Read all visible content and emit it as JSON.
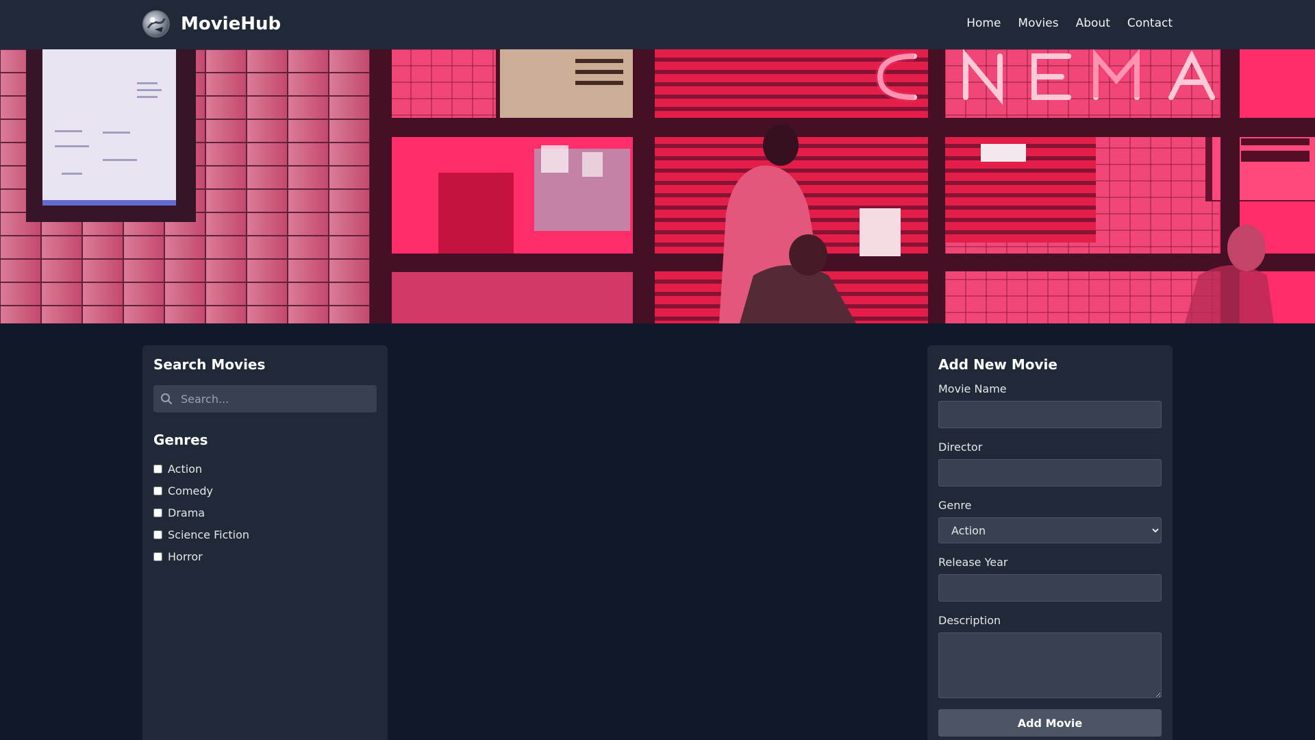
{
  "header": {
    "brand": "MovieHub",
    "nav": [
      "Home",
      "Movies",
      "About",
      "Contact"
    ]
  },
  "hero": {
    "image": "cinema-neon-entrance-photo"
  },
  "search": {
    "title": "Search Movies",
    "placeholder": "Search..."
  },
  "genres": {
    "title": "Genres",
    "items": [
      "Action",
      "Comedy",
      "Drama",
      "Science Fiction",
      "Horror"
    ]
  },
  "add_movie": {
    "title": "Add New Movie",
    "fields": {
      "name_label": "Movie Name",
      "director_label": "Director",
      "genre_label": "Genre",
      "genre_selected": "Action",
      "year_label": "Release Year",
      "description_label": "Description"
    },
    "button": "Add Movie"
  },
  "colors": {
    "background": "#111827",
    "panel": "#1f2937",
    "input": "#374151",
    "button": "#4b5563",
    "hero_accent": "#ff2d6b"
  }
}
